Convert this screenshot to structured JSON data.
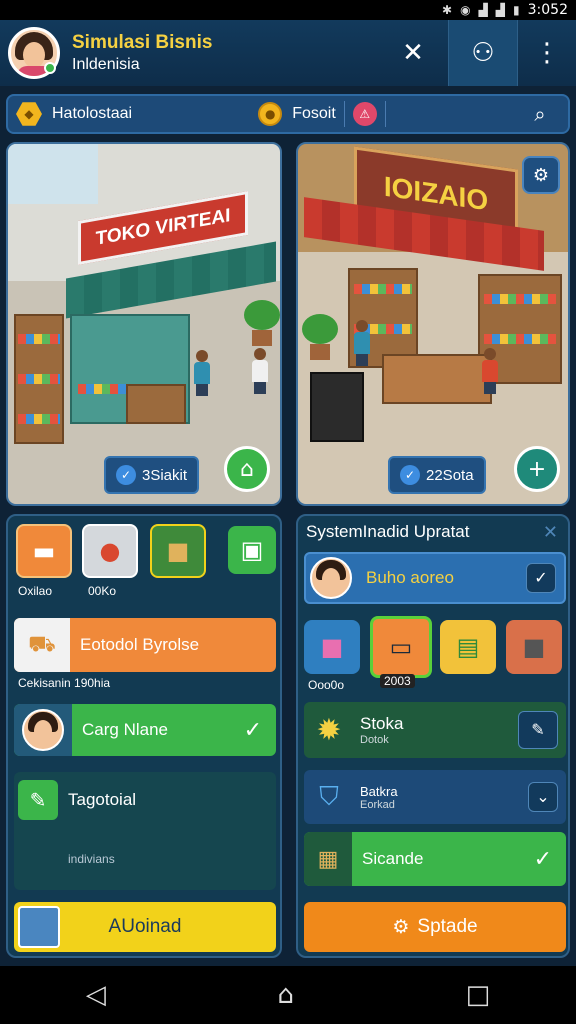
{
  "status": {
    "time": "3:052"
  },
  "header": {
    "title": "Simulasi Bisnis",
    "subtitle": "Inldenisia"
  },
  "resources": {
    "item1": "Hatolostaai",
    "item2": "Fosoit"
  },
  "stores": [
    {
      "sign": "TOKO VIRTEAI",
      "count": "3Siakit"
    },
    {
      "sign": "IOIZAIO",
      "count": "22Sota"
    }
  ],
  "left_panel": {
    "tiles": [
      {
        "label": "Oxilao"
      },
      {
        "label": "00Ko"
      }
    ],
    "row1": {
      "label": "Eotodol Byrolse",
      "caption": "Cekisanin 190hia"
    },
    "row2": {
      "label": "Carg Nlane"
    },
    "row3": {
      "label": "Tagotoial",
      "caption": "indivians"
    },
    "button": {
      "label": "AUoinad"
    }
  },
  "right_panel": {
    "title": "SystemInadid Upratat",
    "row1": {
      "label": "Buho aoreo"
    },
    "tiles": [
      {
        "label": "Ooo0o"
      },
      {
        "label": "2003"
      }
    ],
    "row2": {
      "label": "Stoka",
      "caption": "Dotok"
    },
    "row3": {
      "label": "Batkra",
      "caption": "Eorkad"
    },
    "row4": {
      "label": "Sicande"
    },
    "button": {
      "label": "Sptade"
    }
  },
  "colors": {
    "accent": "#f5d142",
    "green": "#3bb54a",
    "orange": "#f0893a",
    "yellow": "#f2d21a"
  }
}
